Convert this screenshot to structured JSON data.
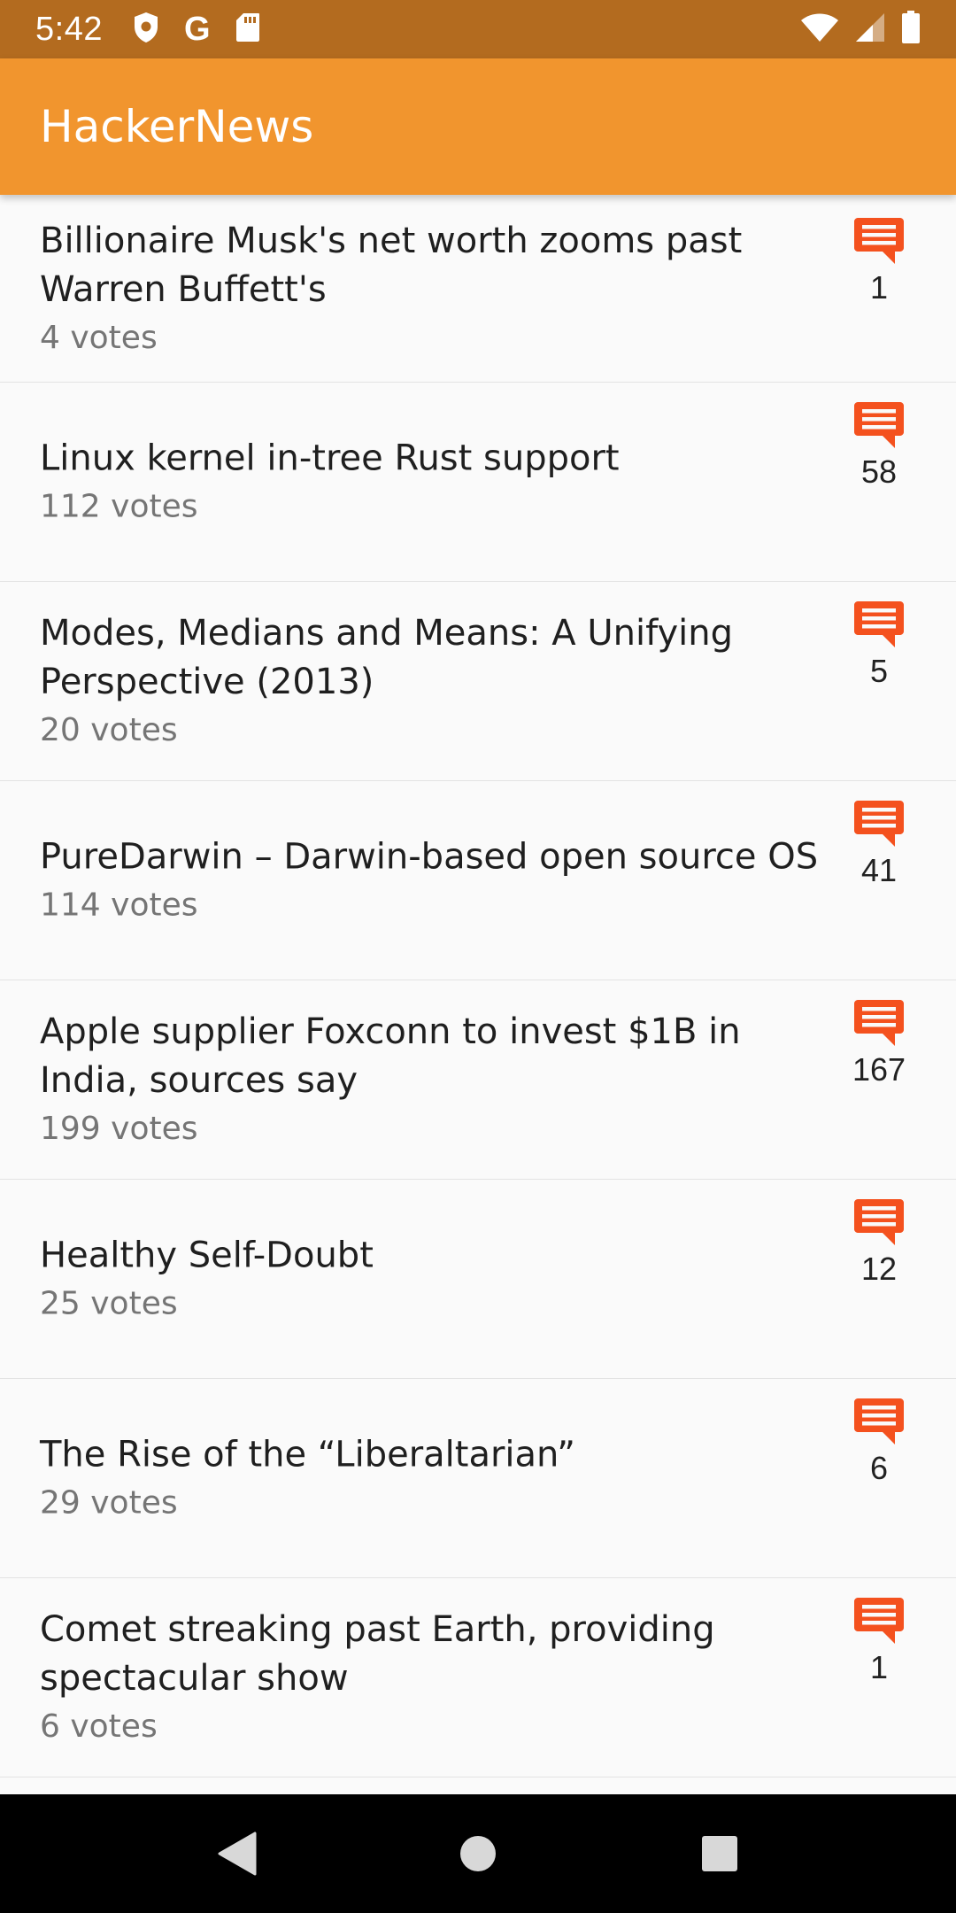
{
  "status_bar": {
    "time": "5:42",
    "left_icons": [
      "shield-icon",
      "google-g-icon",
      "sd-card-icon"
    ],
    "right_icons": [
      "wifi-icon",
      "cell-signal-icon",
      "battery-icon"
    ],
    "google_glyph": "G"
  },
  "app_bar": {
    "title": "HackerNews"
  },
  "colors": {
    "status_bar": "#b36b1f",
    "app_bar": "#f1952e",
    "comment_icon": "#f4511e",
    "background": "#fafafa"
  },
  "stories": [
    {
      "title": "Billionaire Musk's net worth zooms past Warren Buffett's",
      "votes": "4 votes",
      "comments": "1"
    },
    {
      "title": "Linux kernel in-tree Rust support",
      "votes": "112 votes",
      "comments": "58"
    },
    {
      "title": "Modes, Medians and Means: A Unifying Perspective (2013)",
      "votes": "20 votes",
      "comments": "5"
    },
    {
      "title": "PureDarwin – Darwin-based open source OS",
      "votes": "114 votes",
      "comments": "41"
    },
    {
      "title": "Apple supplier Foxconn to invest $1B in India, sources say",
      "votes": "199 votes",
      "comments": "167"
    },
    {
      "title": "Healthy Self-Doubt",
      "votes": "25 votes",
      "comments": "12"
    },
    {
      "title": "The Rise of the “Liberaltarian”",
      "votes": "29 votes",
      "comments": "6"
    },
    {
      "title": "Comet streaking past Earth, providing spectacular show",
      "votes": "6 votes",
      "comments": "1"
    }
  ],
  "nav_bar": {
    "buttons": [
      "back-icon",
      "home-icon",
      "recents-icon"
    ]
  }
}
